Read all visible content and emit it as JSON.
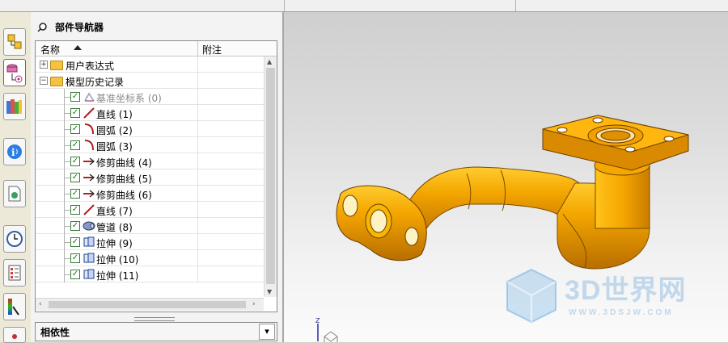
{
  "panel": {
    "title": "部件导航器"
  },
  "tree": {
    "columns": {
      "name": "名称",
      "note": "附注"
    },
    "rows": [
      {
        "label": "用户表达式",
        "type": "folder",
        "expand": "+"
      },
      {
        "label": "模型历史记录",
        "type": "folder",
        "expand": "−"
      },
      {
        "label": "基准坐标系 (0)",
        "type": "feature",
        "icon": "datum-csys-icon",
        "greyed": true
      },
      {
        "label": "直线 (1)",
        "type": "feature",
        "icon": "line-icon"
      },
      {
        "label": "圆弧 (2)",
        "type": "feature",
        "icon": "arc-icon"
      },
      {
        "label": "圆弧 (3)",
        "type": "feature",
        "icon": "arc-icon"
      },
      {
        "label": "修剪曲线 (4)",
        "type": "feature",
        "icon": "trim-curve-icon"
      },
      {
        "label": "修剪曲线 (5)",
        "type": "feature",
        "icon": "trim-curve-icon"
      },
      {
        "label": "修剪曲线 (6)",
        "type": "feature",
        "icon": "trim-curve-icon"
      },
      {
        "label": "直线 (7)",
        "type": "feature",
        "icon": "line-icon"
      },
      {
        "label": "管道 (8)",
        "type": "feature",
        "icon": "tube-icon"
      },
      {
        "label": "拉伸 (9)",
        "type": "feature",
        "icon": "extrude-icon"
      },
      {
        "label": "拉伸 (10)",
        "type": "feature",
        "icon": "extrude-icon"
      },
      {
        "label": "拉伸 (11)",
        "type": "feature",
        "icon": "extrude-icon"
      }
    ]
  },
  "dependencies": {
    "title": "相依性"
  },
  "watermark": {
    "text": "3D世界网",
    "url": "WWW.3DSJW.COM"
  },
  "triad": {
    "z_label": "Z"
  },
  "colors": {
    "part": "#f5a700",
    "check": "#108010",
    "folder": "#f5c242"
  }
}
